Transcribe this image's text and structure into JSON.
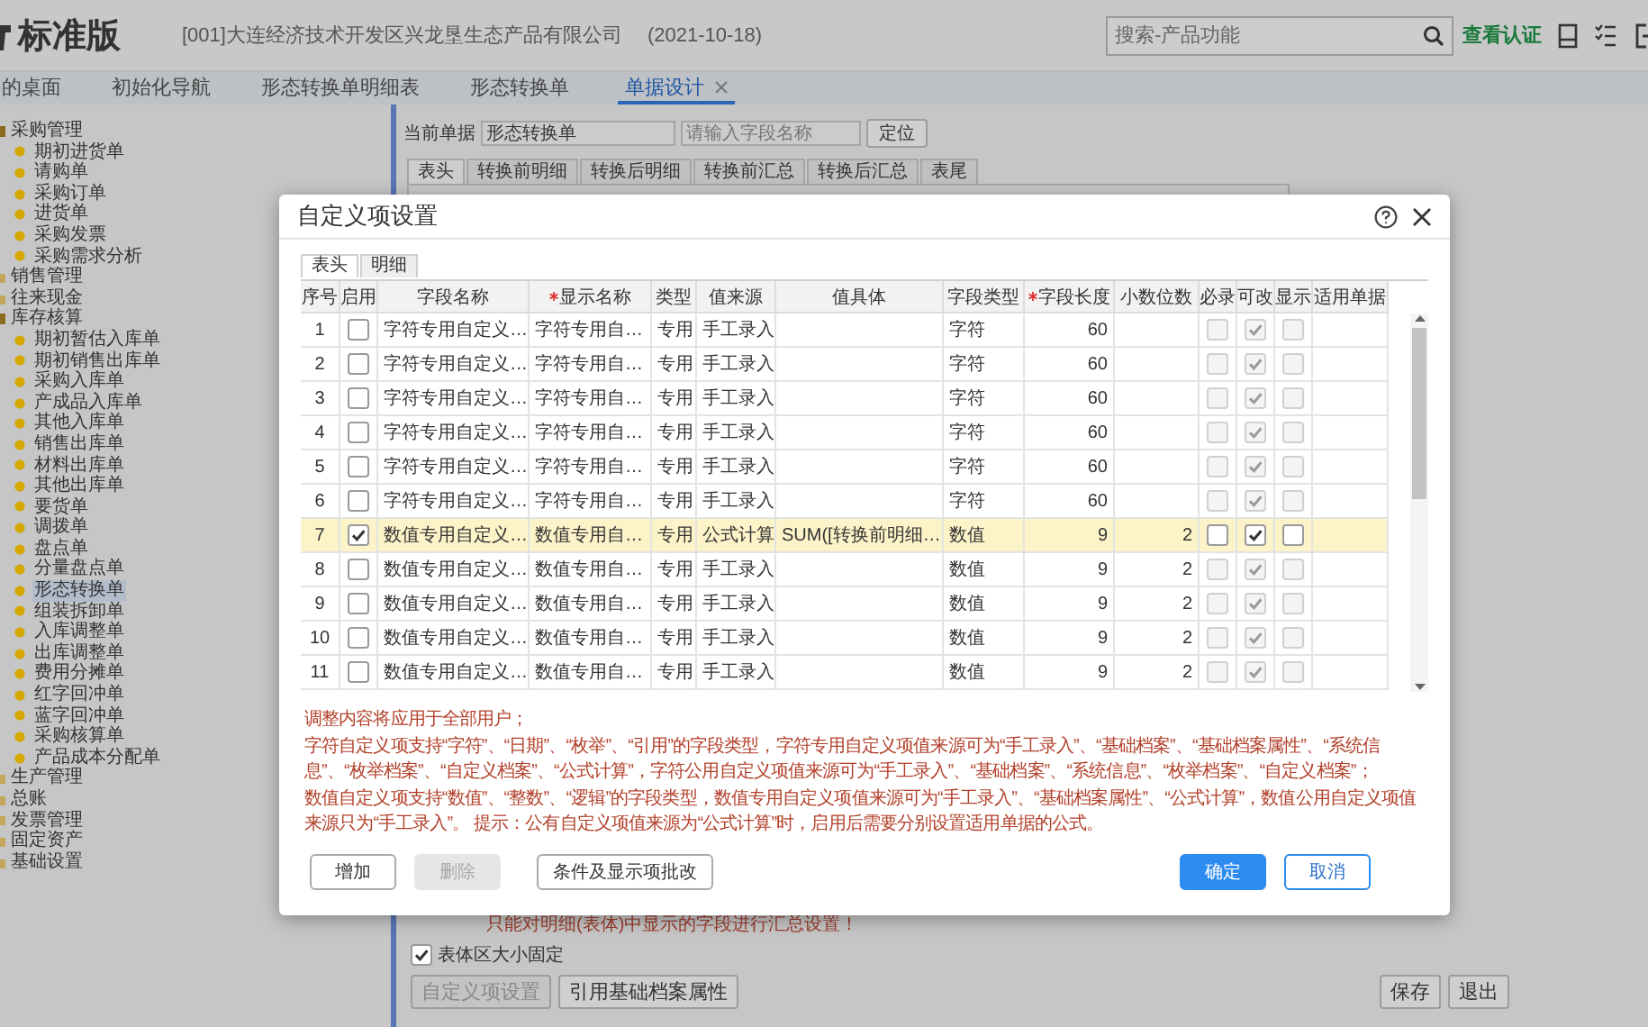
{
  "header": {
    "title": "标准版",
    "company": "[001]大连经济技术开发区兴龙垦生态产品有限公司",
    "date": "(2021-10-18)",
    "search": {
      "placeholder": "搜索-产品功能"
    },
    "link": "查看认证"
  },
  "tabs": [
    {
      "label": "的桌面",
      "selected": false,
      "closable": false
    },
    {
      "label": "初始化导航",
      "selected": false,
      "closable": false
    },
    {
      "label": "形态转换单明细表",
      "selected": false,
      "closable": false
    },
    {
      "label": "形态转换单",
      "selected": false,
      "closable": false
    },
    {
      "label": "单据设计",
      "selected": true,
      "closable": true
    }
  ],
  "sidebar": {
    "items": [
      {
        "label": "采购管理",
        "expanded": true,
        "selected": false,
        "children": [
          {
            "label": "期初进货单",
            "selected": false
          },
          {
            "label": "请购单",
            "selected": false
          },
          {
            "label": "采购订单",
            "selected": false
          },
          {
            "label": "进货单",
            "selected": false
          },
          {
            "label": "采购发票",
            "selected": false
          },
          {
            "label": "采购需求分析",
            "selected": false
          }
        ]
      },
      {
        "label": "销售管理",
        "expanded": false,
        "selected": false
      },
      {
        "label": "往来现金",
        "expanded": false,
        "selected": false
      },
      {
        "label": "库存核算",
        "expanded": true,
        "selected": false,
        "children": [
          {
            "label": "期初暂估入库单",
            "selected": false
          },
          {
            "label": "期初销售出库单",
            "selected": false
          },
          {
            "label": "采购入库单",
            "selected": false
          },
          {
            "label": "产成品入库单",
            "selected": false
          },
          {
            "label": "其他入库单",
            "selected": false
          },
          {
            "label": "销售出库单",
            "selected": false
          },
          {
            "label": "材料出库单",
            "selected": false
          },
          {
            "label": "其他出库单",
            "selected": false
          },
          {
            "label": "要货单",
            "selected": false
          },
          {
            "label": "调拨单",
            "selected": false
          },
          {
            "label": "盘点单",
            "selected": false
          },
          {
            "label": "分量盘点单",
            "selected": false
          },
          {
            "label": "形态转换单",
            "selected": true
          },
          {
            "label": "组装拆卸单",
            "selected": false
          },
          {
            "label": "入库调整单",
            "selected": false
          },
          {
            "label": "出库调整单",
            "selected": false
          },
          {
            "label": "费用分摊单",
            "selected": false
          },
          {
            "label": "红字回冲单",
            "selected": false
          },
          {
            "label": "蓝字回冲单",
            "selected": false
          },
          {
            "label": "采购核算单",
            "selected": false
          },
          {
            "label": "产品成本分配单",
            "selected": false
          }
        ]
      },
      {
        "label": "生产管理",
        "expanded": false,
        "selected": false
      },
      {
        "label": "总账",
        "expanded": false,
        "selected": false
      },
      {
        "label": "发票管理",
        "expanded": false,
        "selected": false
      },
      {
        "label": "固定资产",
        "expanded": false,
        "selected": false
      },
      {
        "label": "基础设置",
        "expanded": false,
        "selected": false
      }
    ]
  },
  "form": {
    "current_label": "当前单据",
    "current_value": "形态转换单",
    "field_search": {
      "placeholder": "请输入字段名称"
    },
    "locate_button": "定位",
    "tabs": [
      {
        "label": "表头",
        "selected": true
      },
      {
        "label": "转换前明细",
        "selected": false
      },
      {
        "label": "转换后明细",
        "selected": false
      },
      {
        "label": "转换前汇总",
        "selected": false
      },
      {
        "label": "转换后汇总",
        "selected": false
      },
      {
        "label": "表尾",
        "selected": false
      }
    ],
    "note": "只能对明细(表体)中显示的字段进行汇总设置！",
    "fixed_checkbox": {
      "label": "表体区大小固定",
      "checked": true
    },
    "left_buttons": [
      {
        "label": "自定义项设置",
        "disabled": true
      },
      {
        "label": "引用基础档案属性",
        "disabled": false
      }
    ],
    "right_buttons": [
      {
        "label": "保存",
        "disabled": false
      },
      {
        "label": "退出",
        "disabled": false
      }
    ]
  },
  "dialog": {
    "title": "自定义项设置",
    "tabs": [
      {
        "label": "表头",
        "selected": true
      },
      {
        "label": "明细",
        "selected": false
      }
    ],
    "table": {
      "columns": [
        {
          "label": "序号",
          "kind": "index",
          "required": false
        },
        {
          "label": "启用",
          "kind": "check",
          "required": false
        },
        {
          "label": "字段名称",
          "kind": "text",
          "required": false
        },
        {
          "label": "显示名称",
          "kind": "text",
          "required": true
        },
        {
          "label": "类型",
          "kind": "text",
          "required": false
        },
        {
          "label": "值来源",
          "kind": "text",
          "required": false
        },
        {
          "label": "值具体",
          "kind": "text",
          "required": false
        },
        {
          "label": "字段类型",
          "kind": "text",
          "required": false
        },
        {
          "label": "字段长度",
          "kind": "number",
          "required": true
        },
        {
          "label": "小数位数",
          "kind": "number",
          "required": false
        },
        {
          "label": "必录",
          "kind": "check",
          "required": false
        },
        {
          "label": "可改",
          "kind": "check",
          "required": false
        },
        {
          "label": "显示",
          "kind": "check",
          "required": false
        },
        {
          "label": "适用单据",
          "kind": "text",
          "required": false
        }
      ],
      "rows": [
        {
          "no": "1",
          "enabled": false,
          "field_name": "字符专用自定义…",
          "display_name": "字符专用自…",
          "type": "专用",
          "source": "手工录入",
          "field_type": "字符",
          "length": "60",
          "required": false,
          "editable": true,
          "visible": false,
          "disabled": true,
          "selected": false
        },
        {
          "no": "2",
          "enabled": false,
          "field_name": "字符专用自定义…",
          "display_name": "字符专用自…",
          "type": "专用",
          "source": "手工录入",
          "field_type": "字符",
          "length": "60",
          "required": false,
          "editable": true,
          "visible": false,
          "disabled": true,
          "selected": false
        },
        {
          "no": "3",
          "enabled": false,
          "field_name": "字符专用自定义…",
          "display_name": "字符专用自…",
          "type": "专用",
          "source": "手工录入",
          "field_type": "字符",
          "length": "60",
          "required": false,
          "editable": true,
          "visible": false,
          "disabled": true,
          "selected": false
        },
        {
          "no": "4",
          "enabled": false,
          "field_name": "字符专用自定义…",
          "display_name": "字符专用自…",
          "type": "专用",
          "source": "手工录入",
          "field_type": "字符",
          "length": "60",
          "required": false,
          "editable": true,
          "visible": false,
          "disabled": true,
          "selected": false
        },
        {
          "no": "5",
          "enabled": false,
          "field_name": "字符专用自定义…",
          "display_name": "字符专用自…",
          "type": "专用",
          "source": "手工录入",
          "field_type": "字符",
          "length": "60",
          "required": false,
          "editable": true,
          "visible": false,
          "disabled": true,
          "selected": false
        },
        {
          "no": "6",
          "enabled": false,
          "field_name": "字符专用自定义…",
          "display_name": "字符专用自…",
          "type": "专用",
          "source": "手工录入",
          "field_type": "字符",
          "length": "60",
          "required": false,
          "editable": true,
          "visible": false,
          "disabled": true,
          "selected": false
        },
        {
          "no": "7",
          "enabled": true,
          "field_name": "数值专用自定义…",
          "display_name": "数值专用自…",
          "type": "专用",
          "source": "公式计算",
          "value": "SUM([转换前明细…",
          "field_type": "数值",
          "length": "9",
          "decimals": "2",
          "required": false,
          "editable": true,
          "visible": false,
          "disabled": false,
          "selected": true
        },
        {
          "no": "8",
          "enabled": false,
          "field_name": "数值专用自定义…",
          "display_name": "数值专用自…",
          "type": "专用",
          "source": "手工录入",
          "field_type": "数值",
          "length": "9",
          "decimals": "2",
          "required": false,
          "editable": true,
          "visible": false,
          "disabled": true,
          "selected": false
        },
        {
          "no": "9",
          "enabled": false,
          "field_name": "数值专用自定义…",
          "display_name": "数值专用自…",
          "type": "专用",
          "source": "手工录入",
          "field_type": "数值",
          "length": "9",
          "decimals": "2",
          "required": false,
          "editable": true,
          "visible": false,
          "disabled": true,
          "selected": false
        },
        {
          "no": "10",
          "enabled": false,
          "field_name": "数值专用自定义…",
          "display_name": "数值专用自…",
          "type": "专用",
          "source": "手工录入",
          "field_type": "数值",
          "length": "9",
          "decimals": "2",
          "required": false,
          "editable": true,
          "visible": false,
          "disabled": true,
          "selected": false
        },
        {
          "no": "11",
          "enabled": false,
          "field_name": "数值专用自定义…",
          "display_name": "数值专用自…",
          "type": "专用",
          "source": "手工录入",
          "field_type": "数值",
          "length": "9",
          "decimals": "2",
          "required": false,
          "editable": true,
          "visible": false,
          "disabled": true,
          "selected": false
        }
      ]
    },
    "notes": [
      "调整内容将应用于全部用户；",
      "字符自定义项支持“字符”、“日期”、“枚举”、“引用”的字段类型，字符专用自定义项值来源可为“手工录入”、“基础档案”、“基础档案属性”、“系统信息”、“枚举档案”、“自定义档案”、“公式计算”，字符公用自定义项值来源可为“手工录入”、“基础档案”、“系统信息”、“枚举档案”、“自定义档案”；",
      "数值自定义项支持“数值”、“整数”、“逻辑”的字段类型，数值专用自定义项值来源可为“手工录入”、“基础档案属性”、“公式计算”，数值公用自定义项值来源只为“手工录入”。 提示：公有自定义项值来源为“公式计算”时，启用后需要分别设置适用单据的公式。"
    ],
    "left_buttons": [
      {
        "label": "增加",
        "disabled": false
      },
      {
        "label": "删除",
        "disabled": true
      },
      {
        "label": "条件及显示项批改",
        "disabled": false
      }
    ],
    "right_buttons": [
      {
        "label": "确定",
        "kind": "primary",
        "disabled": false
      },
      {
        "label": "取消",
        "kind": "outline",
        "disabled": false
      }
    ]
  }
}
